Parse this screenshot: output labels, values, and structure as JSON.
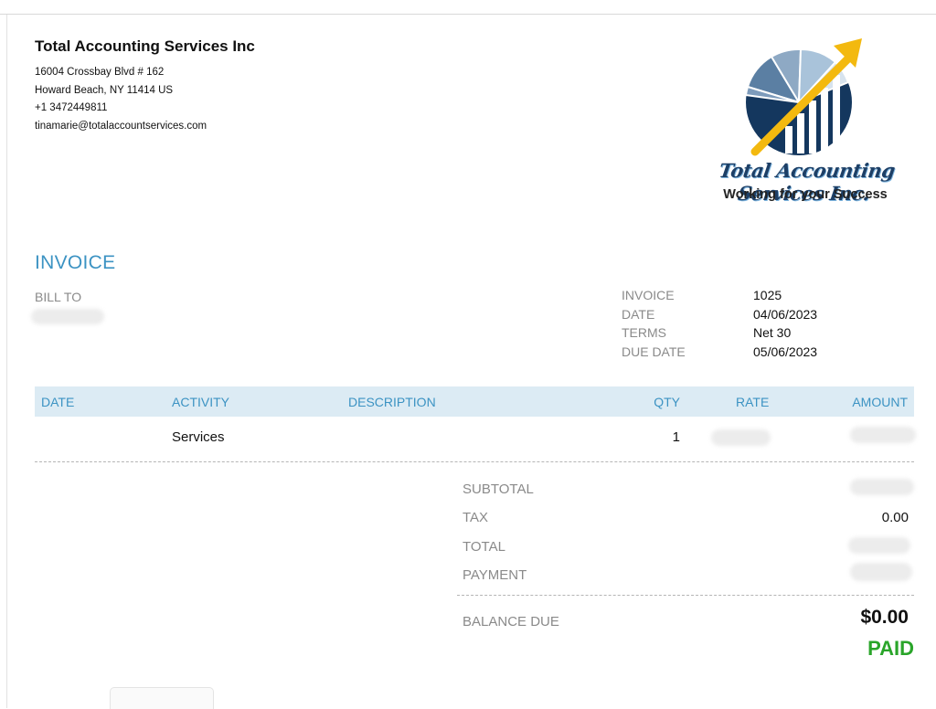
{
  "company": {
    "name": "Total Accounting Services Inc",
    "address_line1": "16004 Crossbay Blvd  # 162",
    "address_line2": "Howard Beach, NY  11414 US",
    "phone": "+1 3472449811",
    "email": "tinamarie@totalaccountservices.com"
  },
  "logo": {
    "title": "Total Accounting Services Inc.",
    "tagline": "Working for your Success",
    "colors": {
      "navy": "#14375e",
      "slate": "#5b7fa3",
      "light": "#a9c3da",
      "arrow": "#f3b90f"
    }
  },
  "invoice": {
    "heading": "INVOICE",
    "bill_to_label": "BILL TO",
    "meta": [
      {
        "label": "INVOICE",
        "value": "1025"
      },
      {
        "label": "DATE",
        "value": "04/06/2023"
      },
      {
        "label": "TERMS",
        "value": "Net 30"
      },
      {
        "label": "DUE DATE",
        "value": "05/06/2023"
      }
    ]
  },
  "table": {
    "headers": {
      "date": "DATE",
      "activity": "ACTIVITY",
      "description": "DESCRIPTION",
      "qty": "QTY",
      "rate": "RATE",
      "amount": "AMOUNT"
    },
    "rows": [
      {
        "date": "",
        "activity": "Services",
        "description": "",
        "qty": "1"
      }
    ]
  },
  "summary": {
    "subtotal_label": "SUBTOTAL",
    "tax_label": "TAX",
    "tax_value": "0.00",
    "total_label": "TOTAL",
    "payment_label": "PAYMENT",
    "balance_label": "BALANCE DUE",
    "balance_value": "$0.00",
    "status": "PAID"
  },
  "colors": {
    "accent": "#3c93c3",
    "header_bg": "#dcebf4",
    "paid": "#2aa52a"
  }
}
